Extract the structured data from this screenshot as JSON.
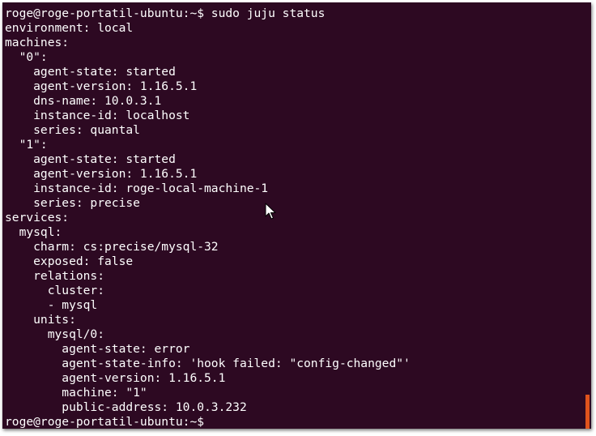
{
  "terminal": {
    "lines": [
      "roge@roge-portatil-ubuntu:~$ sudo juju status",
      "environment: local",
      "machines:",
      "  \"0\":",
      "    agent-state: started",
      "    agent-version: 1.16.5.1",
      "    dns-name: 10.0.3.1",
      "    instance-id: localhost",
      "    series: quantal",
      "  \"1\":",
      "    agent-state: started",
      "    agent-version: 1.16.5.1",
      "    instance-id: roge-local-machine-1",
      "    series: precise",
      "services:",
      "  mysql:",
      "    charm: cs:precise/mysql-32",
      "    exposed: false",
      "    relations:",
      "      cluster:",
      "      - mysql",
      "    units:",
      "      mysql/0:",
      "        agent-state: error",
      "        agent-state-info: 'hook failed: \"config-changed\"'",
      "        agent-version: 1.16.5.1",
      "        machine: \"1\"",
      "        public-address: 10.0.3.232",
      "roge@roge-portatil-ubuntu:~$ "
    ]
  },
  "colors": {
    "background": "#2d0922",
    "text": "#ffffff",
    "scrollbar": "#e0531c"
  },
  "icons": {
    "pointer": "mouse-pointer-icon"
  }
}
